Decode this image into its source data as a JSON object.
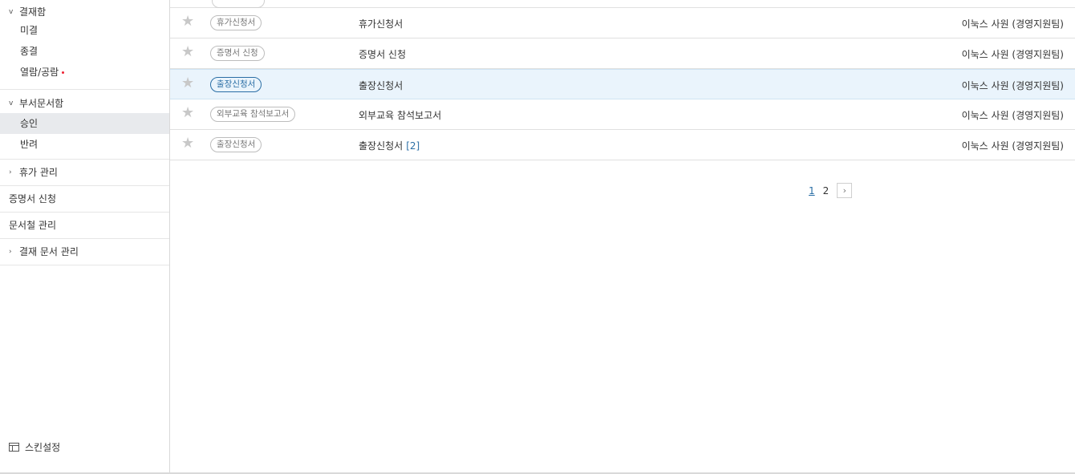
{
  "sidebar": {
    "approval_box": {
      "label": "결재함",
      "items": [
        {
          "label": "미결"
        },
        {
          "label": "종결"
        },
        {
          "label": "열람/공람"
        }
      ]
    },
    "dept_box": {
      "label": "부서문서함",
      "items": [
        {
          "label": "승인"
        },
        {
          "label": "반려"
        }
      ]
    },
    "vacation": {
      "label": "휴가 관리"
    },
    "certificate": {
      "label": "증명서 신청"
    },
    "binder": {
      "label": "문서철 관리"
    },
    "doc_manage": {
      "label": "결재 문서 관리"
    },
    "skin": {
      "label": "스킨설정"
    }
  },
  "documents": [
    {
      "tag": "휴가신청서",
      "title": "휴가신청서",
      "count": "",
      "writer": "이눅스 사원 (경영지원팀)"
    },
    {
      "tag": "증명서 신청",
      "title": "증명서 신청",
      "count": "",
      "writer": "이눅스 사원 (경영지원팀)"
    },
    {
      "tag": "출장신청서",
      "title": "출장신청서",
      "count": "",
      "writer": "이눅스 사원 (경영지원팀)"
    },
    {
      "tag": "외부교육 참석보고서",
      "title": "외부교육 참석보고서",
      "count": "",
      "writer": "이눅스 사원 (경영지원팀)"
    },
    {
      "tag": "출장신청서",
      "title": "출장신청서",
      "count": "[2]",
      "writer": "이눅스 사원 (경영지원팀)"
    }
  ],
  "pagination": {
    "pages": [
      "1",
      "2"
    ],
    "current": "1",
    "next_glyph": "›"
  },
  "icons": {
    "caret_open": "⌄",
    "caret_closed": "›",
    "star": "★"
  },
  "colors": {
    "accent": "#2a6ea5",
    "highlight_row": "#eaf4fc",
    "selected_item": "#e8eaed",
    "new_dot": "#e23"
  }
}
